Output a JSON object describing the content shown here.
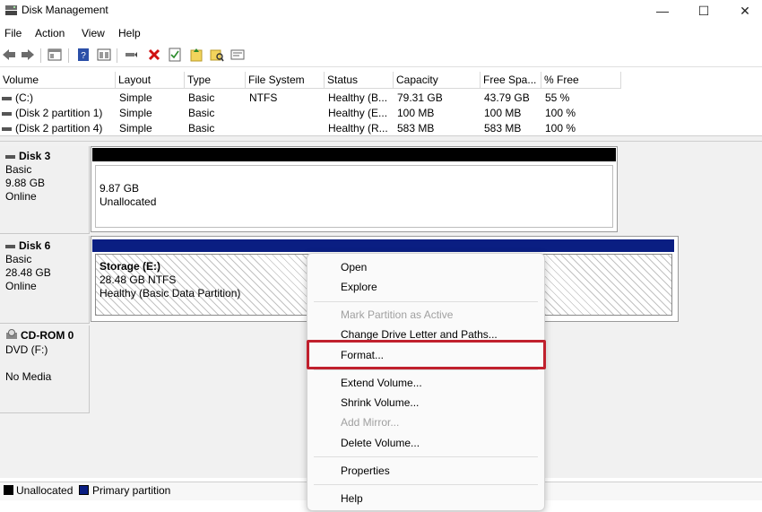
{
  "window": {
    "title": "Disk Management",
    "minimize_glyph": "—",
    "maximize_glyph": "☐",
    "close_glyph": "✕"
  },
  "menubar": [
    "File",
    "Action",
    "View",
    "Help"
  ],
  "toolbar": {
    "icons": [
      "back-arrow-icon",
      "forward-arrow-icon",
      "console-tree-icon",
      "help-book-icon",
      "properties-panel-icon",
      "connect-icon",
      "delete-x-icon",
      "checklist-icon",
      "folder-up-icon",
      "search-folder-icon",
      "properties-icon"
    ]
  },
  "volume_list": {
    "columns": [
      "Volume",
      "Layout",
      "Type",
      "File System",
      "Status",
      "Capacity",
      "Free Spa...",
      "% Free"
    ],
    "rows": [
      [
        "(C:)",
        "Simple",
        "Basic",
        "NTFS",
        "Healthy (B...",
        "79.31 GB",
        "43.79 GB",
        "55 %"
      ],
      [
        "(Disk 2 partition 1)",
        "Simple",
        "Basic",
        "",
        "Healthy (E...",
        "100 MB",
        "100 MB",
        "100 %"
      ],
      [
        "(Disk 2 partition 4)",
        "Simple",
        "Basic",
        "",
        "Healthy (R...",
        "583 MB",
        "583 MB",
        "100 %"
      ]
    ]
  },
  "disks": [
    {
      "name": "Disk 3",
      "type": "Basic",
      "size": "9.88 GB",
      "state": "Online",
      "partition": {
        "size": "9.87 GB",
        "status": "Unallocated"
      }
    },
    {
      "name": "Disk 6",
      "type": "Basic",
      "size": "28.48 GB",
      "state": "Online",
      "partition": {
        "label": "Storage  (E:)",
        "size": "28.48 GB NTFS",
        "status": "Healthy (Basic Data Partition)"
      }
    },
    {
      "name": "CD-ROM 0",
      "type": "DVD (F:)",
      "size": "",
      "state": "No Media"
    }
  ],
  "legend": [
    {
      "label": "Unallocated",
      "color": "#000000"
    },
    {
      "label": "Primary partition",
      "color": "#0a1e82"
    }
  ],
  "context_menu": {
    "items": [
      "Open",
      "Explore",
      "Mark Partition as Active",
      "Change Drive Letter and Paths...",
      "Format...",
      "Extend Volume...",
      "Shrink Volume...",
      "Add Mirror...",
      "Delete Volume...",
      "Properties",
      "Help"
    ],
    "disabled": [
      "Mark Partition as Active",
      "Add Mirror..."
    ],
    "highlighted": "Format..."
  },
  "colors": {
    "unallocated_bar": "#000000",
    "primary_bar": "#0a1e82",
    "highlight_border": "#c0202d"
  }
}
